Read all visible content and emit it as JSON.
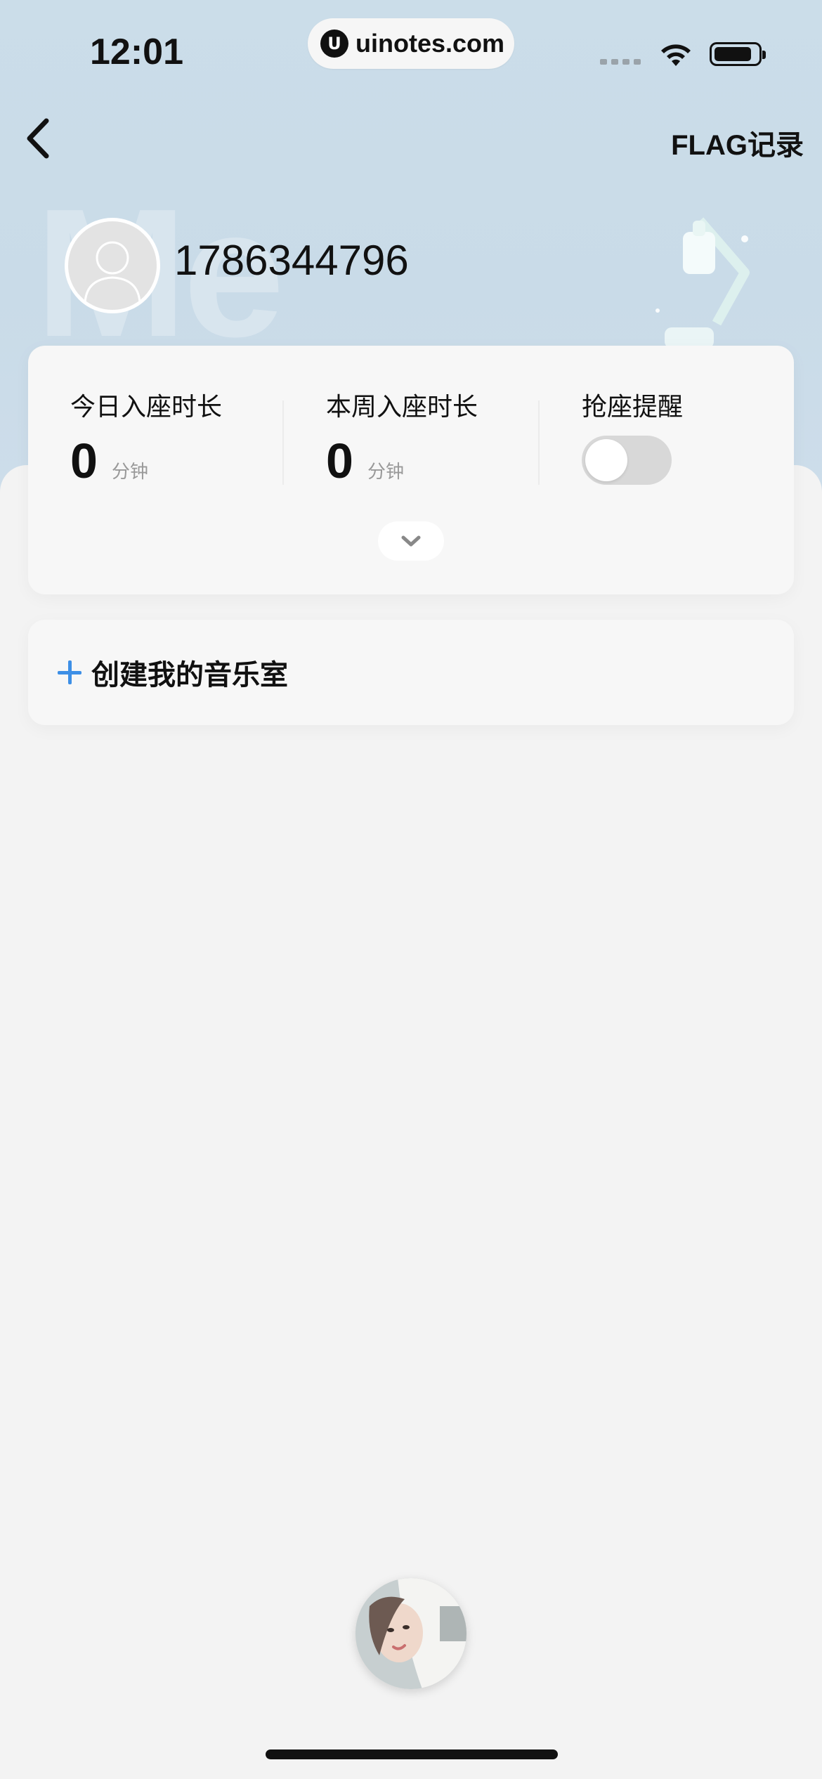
{
  "status_bar": {
    "time": "12:01",
    "site": "uinotes.com",
    "site_logo": "U"
  },
  "nav": {
    "flag_label": "FLAG记录"
  },
  "profile": {
    "watermark": "Me",
    "user_id": "1786344796"
  },
  "stats": {
    "today": {
      "label": "今日入座时长",
      "value": "0",
      "unit": "分钟"
    },
    "week": {
      "label": "本周入座时长",
      "value": "0",
      "unit": "分钟"
    },
    "reminder": {
      "label": "抢座提醒",
      "enabled": false
    }
  },
  "create": {
    "label": "创建我的音乐室"
  },
  "colors": {
    "accent": "#3d8fe6",
    "header_bg": "#cbdde9",
    "page_bg": "#f3f3f3"
  }
}
